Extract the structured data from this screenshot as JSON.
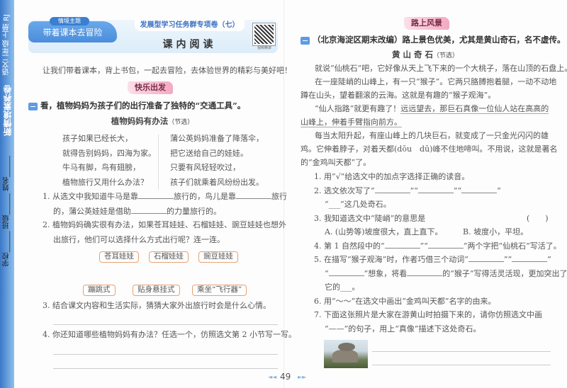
{
  "spine": {
    "series": "新情境素养卷",
    "subject": "语文二年级 上册 RJ",
    "fields": "学校______ 班级______ 姓名______"
  },
  "header": {
    "theme_label": "情境主题",
    "theme": "带着课本去冒险",
    "series_title": "发展型学习任务群专项卷（七）",
    "unit_title": "课内阅读",
    "qr_caption": "视频精讲"
  },
  "intro": "让我们带着课本，背上书包，一起去冒险，去体验世界的精彩与美好吧！",
  "left": {
    "badge": "快乐出发",
    "section_num": "一",
    "section_text": "看，植物妈妈为孩子们的出行准备了独特的“交通工具”。",
    "poem_title": "植物妈妈有办法",
    "poem_note": "（节选）",
    "poem_left": [
      "孩子如果已经长大，",
      "就得告别妈妈，四海为家。",
      "牛马有脚，鸟有翅膀，",
      "植物旅行又用什么办法？"
    ],
    "poem_right": [
      "蒲公英妈妈准备了降落伞，",
      "把它送给自己的娃娃。",
      "只要有风轻轻吹过，",
      "孩子们就乘着风纷纷出发。"
    ],
    "q1": [
      "1. 从选文中我知道牛马是靠___旅行的，鸟儿是靠___旅行",
      "的，蒲公英娃娃是借助___的力量旅行的。"
    ],
    "q2": [
      "2. 植物妈妈确实很有办法，如果苍耳娃娃、石榴娃娃、豌豆娃娃也想外",
      "出旅行，他们可以选择什么方式出行呢？连一连。"
    ],
    "match_top": [
      "苍耳娃娃",
      "石榴娃娃",
      "豌豆娃娃"
    ],
    "match_bottom": [
      "蹦跳式",
      "贴身悬挂式",
      "乘坐“飞行器”"
    ],
    "q3": "3. 结合课文内容和生活实际，猜猜大家外出旅行时会是什么心情。",
    "q4": "4. 你还知道哪些植物妈妈有办法？任选一个，仿照选文第 2 小节写一写。"
  },
  "right": {
    "badge": "路上风景",
    "section_num": "二",
    "section_text": "（北京海淀区期末改编）路上景色优美，尤其是黄山奇石，名不虚传。",
    "passage_title": "黄 山 奇 石",
    "passage_note": "（节选）",
    "p1": "就说“仙桃石”吧，它好像从天上飞下来的一个大桃子，落在山顶的石盘上。",
    "p2": [
      "在一座陡峭的山峰上，有一只“猴子”。它两只胳膊抱着腿，一动不动地",
      "蹲在山头，望着翻滚的云海。这就是有趣的“猴子观海”。"
    ],
    "p3_plain": "“仙人指路”就更有趣了！",
    "p3_underlined": "远远望去，那巨石真像一位仙人站在高高的",
    "p3_underlined_2": "山峰上，伸着手臂指向前方。",
    "p4": [
      "每当太阳升起，有座山峰上的几块巨石，就变成了一只金光闪闪的雄",
      "鸡。它伸着脖子，对着天都(dōu　dū)峰不住地啼叫。不用说，这就是著名",
      "的“金鸡叫天都”了。"
    ],
    "q1": "1. 用“√”给选文中的加点字选择正确的读音。",
    "q2": [
      "2. 选文依次写了“___”“___”“___”",
      "“___”这几处奇石。"
    ],
    "q3": "3. 我知道选文中“陡峭”的意思是",
    "q3_paren": "(　　)",
    "q3_a": "A. (山势等)坡度很大，直上直下。",
    "q3_b": "B. 坡度小，平坦。",
    "q4": "4. 第 1 自然段中的“___”“___”两个字把“仙桃石”写活了。",
    "q5": [
      "5. 在描写“猴子观海”时，作者巧借三个动词“___”“___”",
      "“___”想象，将看___的“猴子”写得活灵活现，更加突出了",
      "它的___。"
    ],
    "q6": "6. 用“～～”在选文中画出“金鸡叫天都”名字的由来。",
    "q7": [
      "7. 下面这张照片是大家在游黄山时拍摄下来的，请你仿照选文中画",
      "“——”的句子，用上“真像”描述下这处奇石。"
    ]
  },
  "footer": {
    "page_number": "49"
  }
}
